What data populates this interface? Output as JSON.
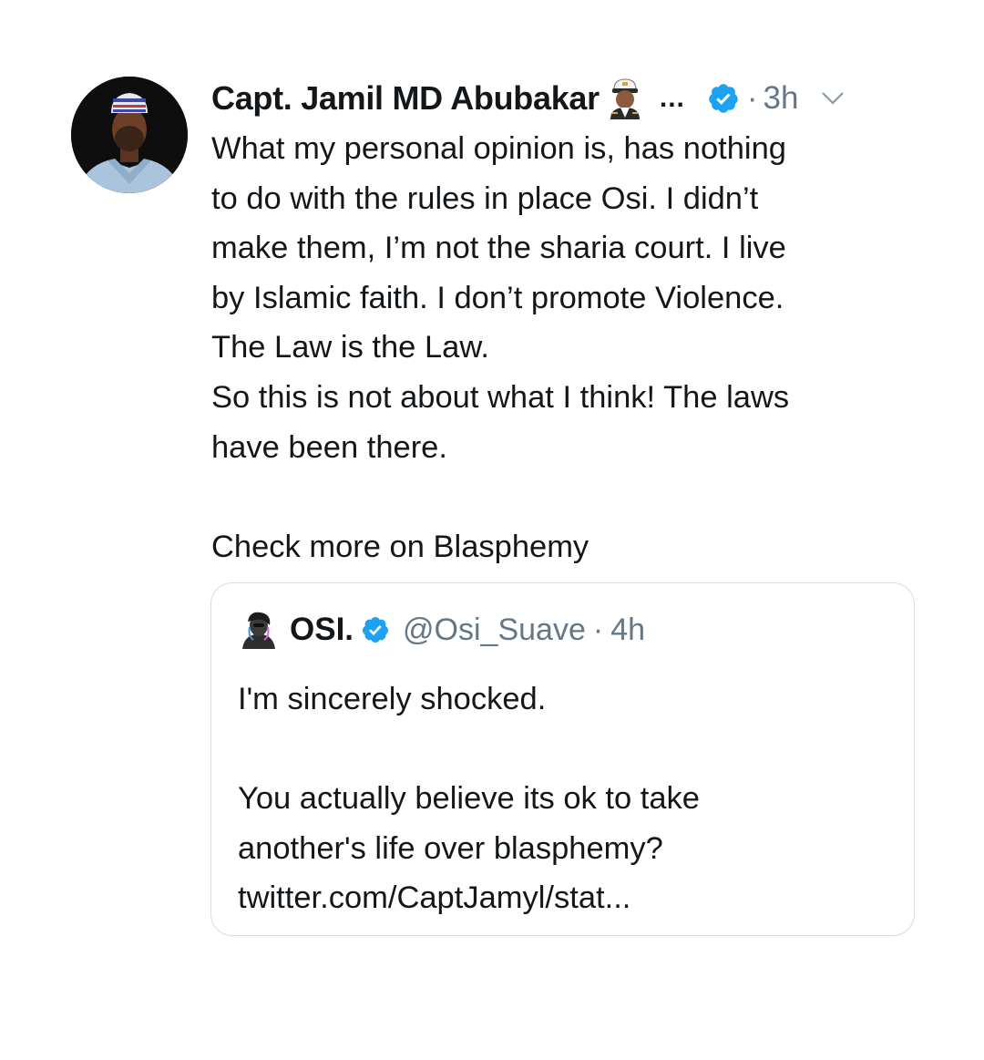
{
  "tweet": {
    "author_name": "Capt. Jamil MD Abubakar",
    "author_emoji_icon": "pilot-emoji",
    "name_ellipsis": "...",
    "verified_icon": "verified-badge-icon",
    "time": "3h",
    "time_separator": "·",
    "more_icon": "chevron-down-icon",
    "lines": [
      "What my personal opinion is, has nothing",
      "to do with the rules in place Osi. I didn’t",
      "make them, I’m not the sharia court. I live",
      "by Islamic faith. I don’t promote Violence.",
      "The Law is the Law.",
      "So this is not about what I think! The laws",
      "have been there.",
      "",
      "Check more on Blasphemy"
    ]
  },
  "quoted_tweet": {
    "author_name": "OSI.",
    "handle": "@Osi_Suave",
    "separator": "·",
    "time": "4h",
    "lines": [
      "I'm sincerely shocked.",
      "",
      "You actually believe its ok to take",
      "another's life over blasphemy?",
      "twitter.com/CaptJamyl/stat..."
    ]
  },
  "colors": {
    "text": "#14171a",
    "secondary": "#657786",
    "verified": "#1da1f2",
    "card_border": "#d6dde3"
  }
}
